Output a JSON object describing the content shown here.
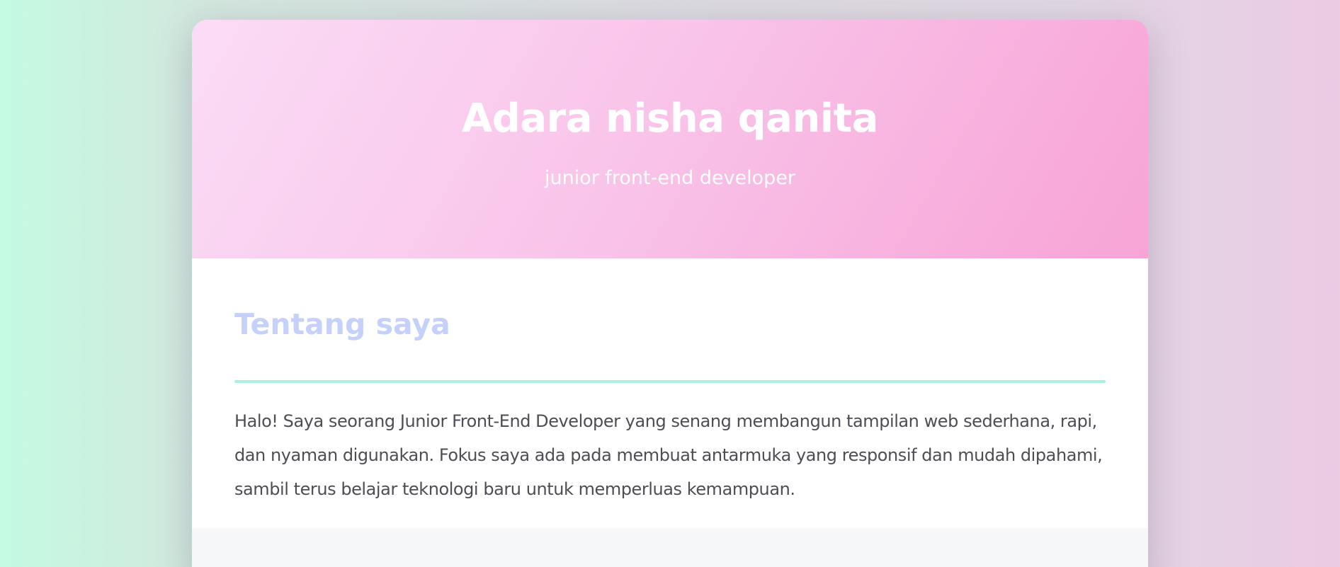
{
  "profile": {
    "name": "Adara nisha qanita",
    "role": "junior front-end developer"
  },
  "about": {
    "heading": "Tentang saya",
    "text": "Halo! Saya seorang Junior Front-End Developer yang senang membangun tampilan web sederhana, rapi, dan nyaman digunakan. Fokus saya ada pada membuat antarmuka yang responsif dan mudah dipahami, sambil terus belajar teknologi baru untuk memperluas kemampuan."
  },
  "colors": {
    "hero_gradient_start": "#fbdcf6",
    "hero_gradient_end": "#f7a3d6",
    "heading_accent": "#c5d0fb",
    "divider_accent": "#a8f2df",
    "body_text": "#4d4d55"
  }
}
